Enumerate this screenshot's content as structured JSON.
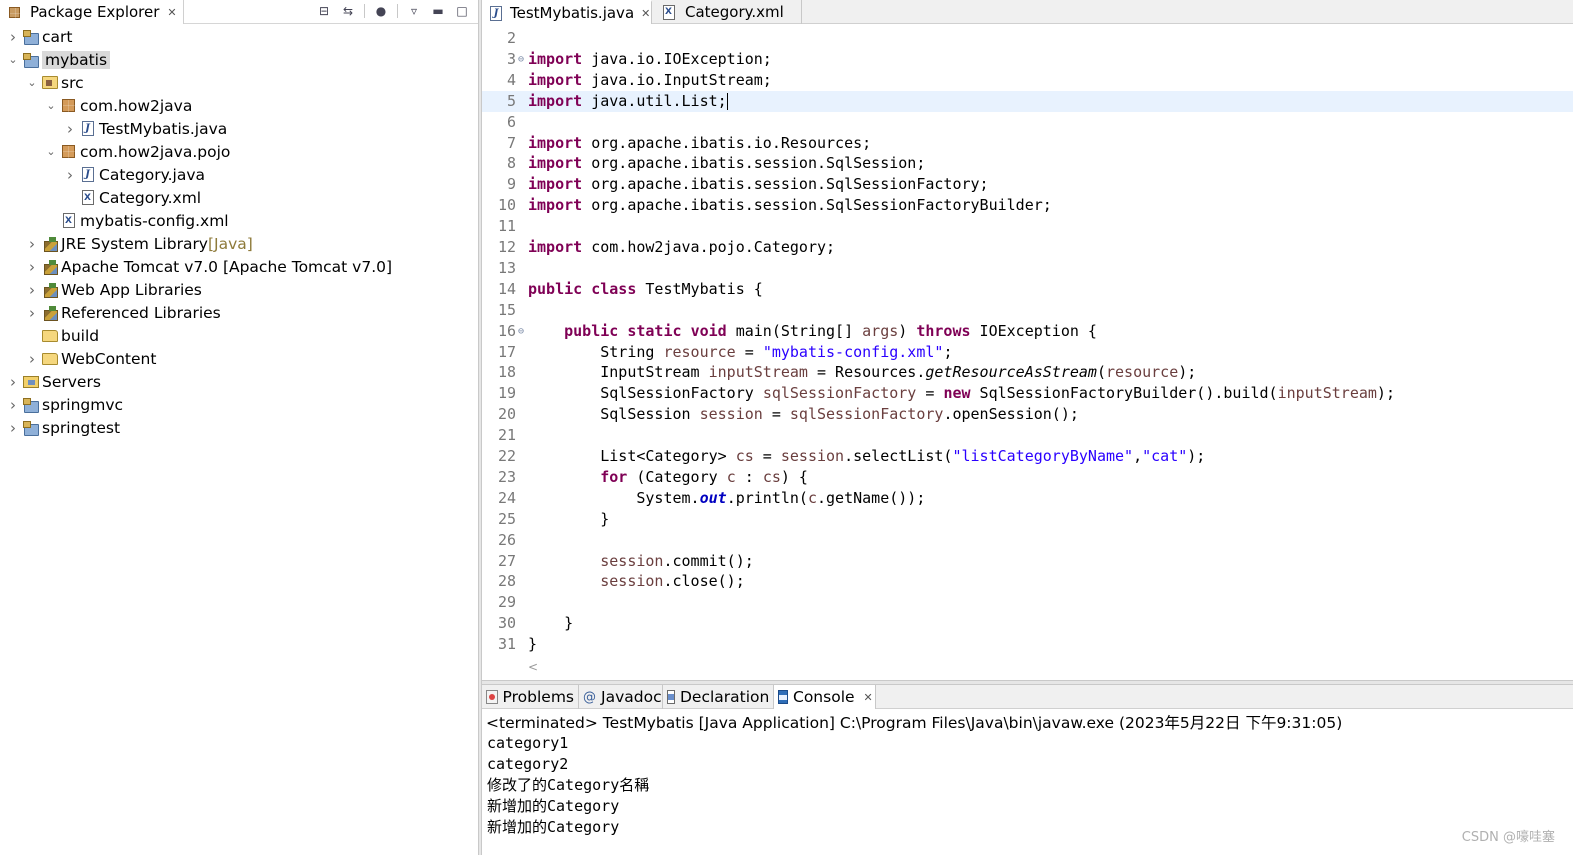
{
  "explorer": {
    "title": "Package Explorer",
    "tree": [
      {
        "label": "cart",
        "decor": "",
        "depth": 0,
        "expand": "collapsed",
        "icon": "project-icon",
        "selected": false
      },
      {
        "label": "mybatis",
        "decor": "",
        "depth": 0,
        "expand": "expanded",
        "icon": "project-icon",
        "selected": true
      },
      {
        "label": "src",
        "decor": "",
        "depth": 1,
        "expand": "expanded",
        "icon": "source-folder-icon",
        "selected": false
      },
      {
        "label": "com.how2java",
        "decor": "",
        "depth": 2,
        "expand": "expanded",
        "icon": "package-icon",
        "selected": false
      },
      {
        "label": "TestMybatis.java",
        "decor": "",
        "depth": 3,
        "expand": "collapsed",
        "icon": "java-file-icon",
        "selected": false
      },
      {
        "label": "com.how2java.pojo",
        "decor": "",
        "depth": 2,
        "expand": "expanded",
        "icon": "package-icon",
        "selected": false
      },
      {
        "label": "Category.java",
        "decor": "",
        "depth": 3,
        "expand": "collapsed",
        "icon": "java-file-icon",
        "selected": false
      },
      {
        "label": "Category.xml",
        "decor": "",
        "depth": 3,
        "expand": "none",
        "icon": "xml-file-icon",
        "selected": false
      },
      {
        "label": "mybatis-config.xml",
        "decor": "",
        "depth": 2,
        "expand": "none",
        "icon": "xml-file-icon",
        "selected": false
      },
      {
        "label": "JRE System Library",
        "decor": "[Java]",
        "depth": 1,
        "expand": "collapsed",
        "icon": "library-icon",
        "selected": false
      },
      {
        "label": "Apache Tomcat v7.0 [Apache Tomcat v7.0]",
        "decor": "",
        "depth": 1,
        "expand": "collapsed",
        "icon": "library-icon",
        "selected": false
      },
      {
        "label": "Web App Libraries",
        "decor": "",
        "depth": 1,
        "expand": "collapsed",
        "icon": "library-icon",
        "selected": false
      },
      {
        "label": "Referenced Libraries",
        "decor": "",
        "depth": 1,
        "expand": "collapsed",
        "icon": "library-icon",
        "selected": false
      },
      {
        "label": "build",
        "decor": "",
        "depth": 1,
        "expand": "none",
        "icon": "folder-icon",
        "selected": false
      },
      {
        "label": "WebContent",
        "decor": "",
        "depth": 1,
        "expand": "collapsed",
        "icon": "folder-icon",
        "selected": false
      },
      {
        "label": "Servers",
        "decor": "",
        "depth": 0,
        "expand": "collapsed",
        "icon": "server-folder-icon",
        "selected": false
      },
      {
        "label": "springmvc",
        "decor": "",
        "depth": 0,
        "expand": "collapsed",
        "icon": "project-icon",
        "selected": false
      },
      {
        "label": "springtest",
        "decor": "",
        "depth": 0,
        "expand": "collapsed",
        "icon": "project-icon",
        "selected": false
      }
    ]
  },
  "editor": {
    "tabs": [
      {
        "label": "TestMybatis.java",
        "icon": "java-file-icon",
        "active": true,
        "closable": true
      },
      {
        "label": "Category.xml",
        "icon": "xml-file-icon",
        "active": false,
        "closable": false
      }
    ],
    "current_line": 5,
    "lines": [
      {
        "n": "2",
        "fold": "",
        "t": [
          [
            "",
            ""
          ]
        ]
      },
      {
        "n": "3",
        "fold": "⊖",
        "t": [
          [
            "kw",
            "import"
          ],
          [
            "",
            " java.io.IOException;"
          ]
        ]
      },
      {
        "n": "4",
        "fold": "",
        "t": [
          [
            "kw",
            "import"
          ],
          [
            "",
            " java.io.InputStream;"
          ]
        ]
      },
      {
        "n": "5",
        "fold": "",
        "t": [
          [
            "kw",
            "import"
          ],
          [
            "",
            " java.util.List;"
          ],
          [
            "caret",
            ""
          ]
        ]
      },
      {
        "n": "6",
        "fold": "",
        "t": [
          [
            "",
            ""
          ]
        ]
      },
      {
        "n": "7",
        "fold": "",
        "t": [
          [
            "kw",
            "import"
          ],
          [
            "",
            " org.apache.ibatis.io.Resources;"
          ]
        ]
      },
      {
        "n": "8",
        "fold": "",
        "t": [
          [
            "kw",
            "import"
          ],
          [
            "",
            " org.apache.ibatis.session.SqlSession;"
          ]
        ]
      },
      {
        "n": "9",
        "fold": "",
        "t": [
          [
            "kw",
            "import"
          ],
          [
            "",
            " org.apache.ibatis.session.SqlSessionFactory;"
          ]
        ]
      },
      {
        "n": "10",
        "fold": "",
        "t": [
          [
            "kw",
            "import"
          ],
          [
            "",
            " org.apache.ibatis.session.SqlSessionFactoryBuilder;"
          ]
        ]
      },
      {
        "n": "11",
        "fold": "",
        "t": [
          [
            "",
            ""
          ]
        ]
      },
      {
        "n": "12",
        "fold": "",
        "t": [
          [
            "kw",
            "import"
          ],
          [
            "",
            " com.how2java.pojo.Category;"
          ]
        ]
      },
      {
        "n": "13",
        "fold": "",
        "t": [
          [
            "",
            ""
          ]
        ]
      },
      {
        "n": "14",
        "fold": "",
        "t": [
          [
            "kw",
            "public"
          ],
          [
            "",
            " "
          ],
          [
            "kw",
            "class"
          ],
          [
            "",
            " TestMybatis {"
          ]
        ]
      },
      {
        "n": "15",
        "fold": "",
        "t": [
          [
            "",
            ""
          ]
        ]
      },
      {
        "n": "16",
        "fold": "⊖",
        "t": [
          [
            "",
            "    "
          ],
          [
            "kw",
            "public"
          ],
          [
            "",
            " "
          ],
          [
            "kw",
            "static"
          ],
          [
            "",
            " "
          ],
          [
            "kw",
            "void"
          ],
          [
            "",
            " main(String[] "
          ],
          [
            "var",
            "args"
          ],
          [
            "",
            ") "
          ],
          [
            "kw",
            "throws"
          ],
          [
            "",
            " IOException {"
          ]
        ]
      },
      {
        "n": "17",
        "fold": "",
        "t": [
          [
            "",
            "        String "
          ],
          [
            "var",
            "resource"
          ],
          [
            "",
            " = "
          ],
          [
            "str",
            "\"mybatis-config.xml\""
          ],
          [
            "",
            ";"
          ]
        ]
      },
      {
        "n": "18",
        "fold": "",
        "t": [
          [
            "",
            "        InputStream "
          ],
          [
            "var",
            "inputStream"
          ],
          [
            "",
            " = Resources."
          ],
          [
            "itm",
            "getResourceAsStream"
          ],
          [
            "",
            "("
          ],
          [
            "var",
            "resource"
          ],
          [
            "",
            ");"
          ]
        ]
      },
      {
        "n": "19",
        "fold": "",
        "t": [
          [
            "",
            "        SqlSessionFactory "
          ],
          [
            "var",
            "sqlSessionFactory"
          ],
          [
            "",
            " = "
          ],
          [
            "kw",
            "new"
          ],
          [
            "",
            " SqlSessionFactoryBuilder().build("
          ],
          [
            "var",
            "inputStream"
          ],
          [
            "",
            ");"
          ]
        ]
      },
      {
        "n": "20",
        "fold": "",
        "t": [
          [
            "",
            "        SqlSession "
          ],
          [
            "var",
            "session"
          ],
          [
            "",
            " = "
          ],
          [
            "var",
            "sqlSessionFactory"
          ],
          [
            "",
            ".openSession();"
          ]
        ]
      },
      {
        "n": "21",
        "fold": "",
        "t": [
          [
            "",
            ""
          ]
        ]
      },
      {
        "n": "22",
        "fold": "",
        "t": [
          [
            "",
            "        List<Category> "
          ],
          [
            "var",
            "cs"
          ],
          [
            "",
            " = "
          ],
          [
            "var",
            "session"
          ],
          [
            "",
            ".selectList("
          ],
          [
            "str",
            "\"listCategoryByName\""
          ],
          [
            "",
            ","
          ],
          [
            "str",
            "\"cat\""
          ],
          [
            "",
            ");"
          ]
        ]
      },
      {
        "n": "23",
        "fold": "",
        "t": [
          [
            "",
            "        "
          ],
          [
            "kw",
            "for"
          ],
          [
            "",
            " (Category "
          ],
          [
            "var",
            "c"
          ],
          [
            "",
            " : "
          ],
          [
            "var",
            "cs"
          ],
          [
            "",
            ") {"
          ]
        ]
      },
      {
        "n": "24",
        "fold": "",
        "t": [
          [
            "",
            "            System."
          ],
          [
            "fld",
            "out"
          ],
          [
            "",
            ".println("
          ],
          [
            "var",
            "c"
          ],
          [
            "",
            ".getName());"
          ]
        ]
      },
      {
        "n": "25",
        "fold": "",
        "t": [
          [
            "",
            "        }"
          ]
        ]
      },
      {
        "n": "26",
        "fold": "",
        "t": [
          [
            "",
            ""
          ]
        ]
      },
      {
        "n": "27",
        "fold": "",
        "t": [
          [
            "",
            "        "
          ],
          [
            "var",
            "session"
          ],
          [
            "",
            ".commit();"
          ]
        ]
      },
      {
        "n": "28",
        "fold": "",
        "t": [
          [
            "",
            "        "
          ],
          [
            "var",
            "session"
          ],
          [
            "",
            ".close();"
          ]
        ]
      },
      {
        "n": "29",
        "fold": "",
        "t": [
          [
            "",
            ""
          ]
        ]
      },
      {
        "n": "30",
        "fold": "",
        "t": [
          [
            "",
            "    }"
          ]
        ]
      },
      {
        "n": "31",
        "fold": "",
        "t": [
          [
            "",
            "}"
          ]
        ]
      }
    ],
    "scroll_left_glyph": "<"
  },
  "bottom": {
    "tabs": [
      {
        "label": "Problems",
        "icon": "problems-icon",
        "active": false
      },
      {
        "label": "Javadoc",
        "icon": "javadoc-icon",
        "active": false
      },
      {
        "label": "Declaration",
        "icon": "declaration-icon",
        "active": false
      },
      {
        "label": "Console",
        "icon": "console-icon",
        "active": true
      }
    ],
    "console_header": "<terminated> TestMybatis [Java Application] C:\\Program Files\\Java\\bin\\javaw.exe (2023年5月22日 下午9:31:05)",
    "output": [
      "category1",
      "category2",
      "修改了的Category名稱",
      "新增加的Category",
      "新增加的Category"
    ]
  },
  "watermark": "CSDN @嚎哇塞",
  "colors": {
    "keyword": "#7f0055",
    "string": "#2a00ff",
    "local_var": "#6a3e3e",
    "static_field": "#0000c0",
    "current_line": "#e8f2fe",
    "selection": "#d9d9d9"
  }
}
